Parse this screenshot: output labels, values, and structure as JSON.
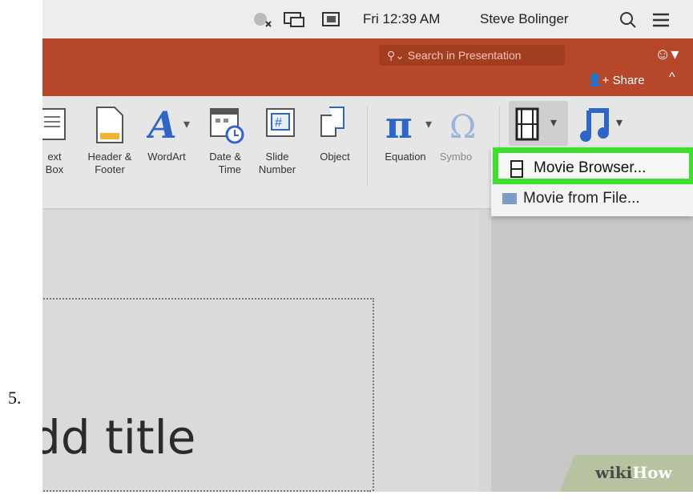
{
  "step": {
    "number": "5."
  },
  "menubar": {
    "datetime": "Fri 12:39 AM",
    "user": "Steve Bolinger",
    "icons": [
      "notification-muted-icon",
      "airplay-display-icon",
      "screen-icon",
      "spotlight-search-icon",
      "notification-center-icon"
    ]
  },
  "titlebar": {
    "search_placeholder": "Search in Presentation",
    "share_label": "Share",
    "accent": "#b7472a"
  },
  "ribbon": {
    "items": [
      {
        "label": "ext\nBox",
        "icon": "text-box-icon"
      },
      {
        "label": "Header &\nFooter",
        "icon": "header-footer-icon"
      },
      {
        "label": "WordArt",
        "icon": "wordart-icon"
      },
      {
        "label": "Date &\nTime",
        "icon": "date-time-icon"
      },
      {
        "label": "Slide\nNumber",
        "icon": "slide-number-icon"
      },
      {
        "label": "Object",
        "icon": "object-icon"
      },
      {
        "label": "Equation",
        "icon": "equation-icon"
      },
      {
        "label": "Symbo",
        "icon": "symbol-icon"
      }
    ],
    "media_icons": [
      "movie-icon",
      "audio-icon"
    ]
  },
  "dropdown": {
    "items": [
      {
        "label": "Movie Browser...",
        "icon": "film-strip-icon"
      },
      {
        "label": "Movie from File...",
        "icon": "file-icon"
      }
    ],
    "highlight_color": "#3de02c"
  },
  "slide": {
    "title_text": "dd title"
  },
  "watermark": {
    "wiki": "wiki",
    "how": "How"
  }
}
